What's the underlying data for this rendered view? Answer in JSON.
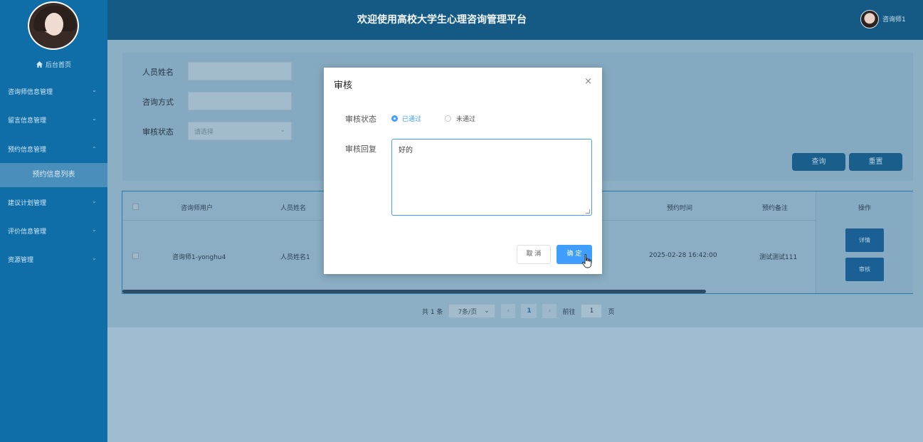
{
  "header": {
    "title": "欢迎使用高校大学生心理咨询管理平台",
    "username": "咨询师1"
  },
  "sidebar": {
    "home_label": "后台首页",
    "items": [
      {
        "label": "咨询师信息管理",
        "expanded": false
      },
      {
        "label": "留言信息管理",
        "expanded": false
      },
      {
        "label": "预约信息管理",
        "expanded": true
      },
      {
        "label": "建议计划管理",
        "expanded": false
      },
      {
        "label": "评价信息管理",
        "expanded": false
      },
      {
        "label": "资源管理",
        "expanded": false
      }
    ],
    "active_subitem": "预约信息列表"
  },
  "search": {
    "name_label": "人员姓名",
    "method_label": "咨询方式",
    "status_label": "审核状态",
    "status_placeholder": "请选择",
    "query_label": "查询",
    "reset_label": "重置"
  },
  "table": {
    "headers": {
      "user": "咨询师用户",
      "name": "人员姓名",
      "time": "预约时间",
      "remark": "预约备注",
      "ops": "操作"
    },
    "rows": [
      {
        "user": "咨询师1-yonghu4",
        "name": "人员姓名1",
        "time": "2025-02-28 16:42:00",
        "remark": "测试测试111",
        "detail_label": "详情",
        "audit_label": "审核"
      }
    ]
  },
  "pagination": {
    "total": "共 1 条",
    "page_size": "7条/页",
    "current_page": "1",
    "goto_label": "前往",
    "goto_value": "1",
    "page_suffix": "页"
  },
  "modal": {
    "title": "审核",
    "status_label": "审核状态",
    "options": [
      "已通过",
      "未通过"
    ],
    "selected": "已通过",
    "reply_label": "审核回复",
    "reply_value": "好的",
    "cancel_label": "取 消",
    "ok_label": "确 定"
  },
  "colors": {
    "sidebar_bg": "#0f6ea8",
    "topbar_bg": "#155a85",
    "primary": "#409eff"
  }
}
